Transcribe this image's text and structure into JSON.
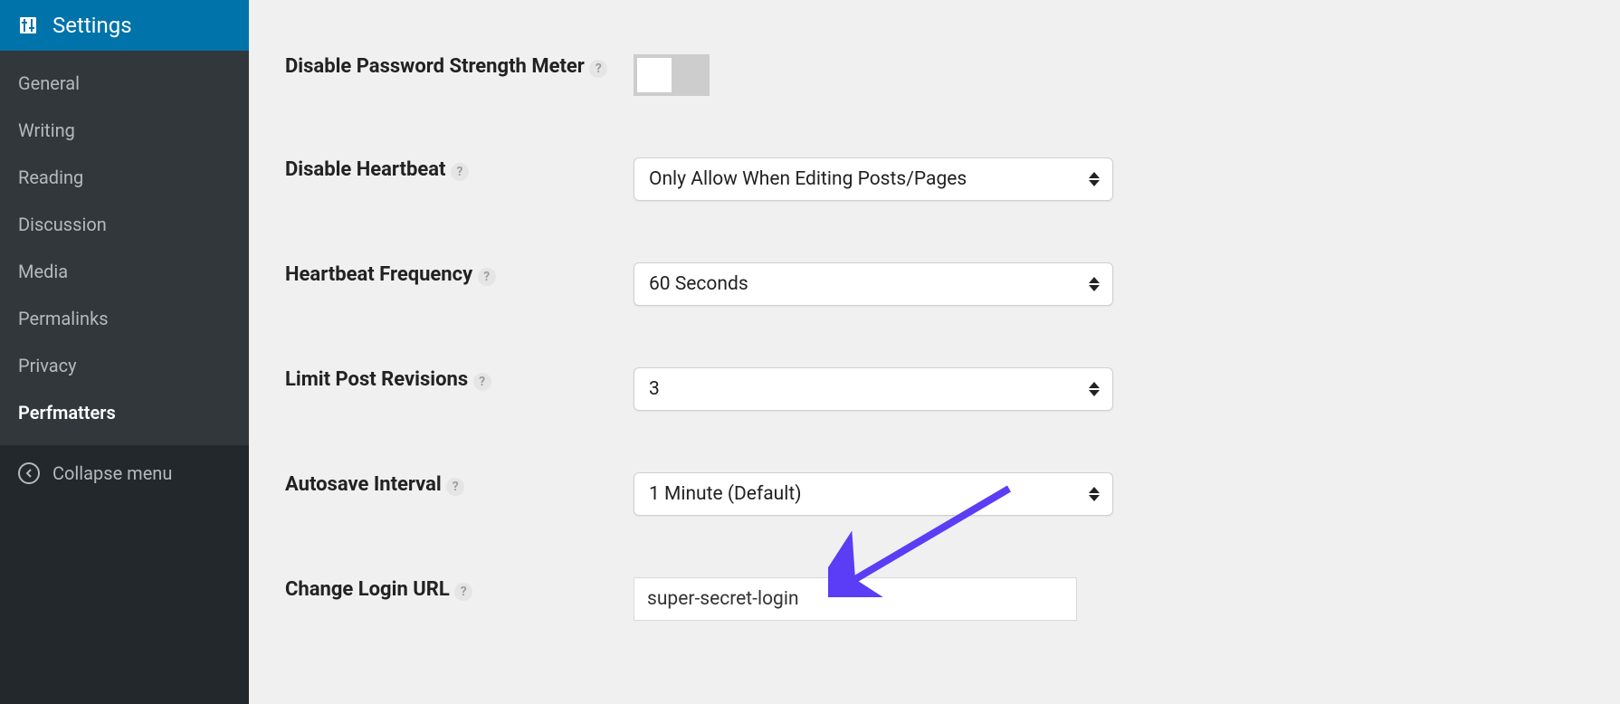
{
  "sidebar": {
    "title": "Settings",
    "items": [
      {
        "label": "General",
        "active": false
      },
      {
        "label": "Writing",
        "active": false
      },
      {
        "label": "Reading",
        "active": false
      },
      {
        "label": "Discussion",
        "active": false
      },
      {
        "label": "Media",
        "active": false
      },
      {
        "label": "Permalinks",
        "active": false
      },
      {
        "label": "Privacy",
        "active": false
      },
      {
        "label": "Perfmatters",
        "active": true
      }
    ],
    "collapse_label": "Collapse menu"
  },
  "form": {
    "disable_password_strength": {
      "label": "Disable Password Strength Meter",
      "checked": false
    },
    "disable_heartbeat": {
      "label": "Disable Heartbeat",
      "value": "Only Allow When Editing Posts/Pages"
    },
    "heartbeat_frequency": {
      "label": "Heartbeat Frequency",
      "value": "60 Seconds"
    },
    "limit_post_revisions": {
      "label": "Limit Post Revisions",
      "value": "3"
    },
    "autosave_interval": {
      "label": "Autosave Interval",
      "value": "1 Minute (Default)"
    },
    "change_login_url": {
      "label": "Change Login URL",
      "value": "super-secret-login"
    }
  }
}
